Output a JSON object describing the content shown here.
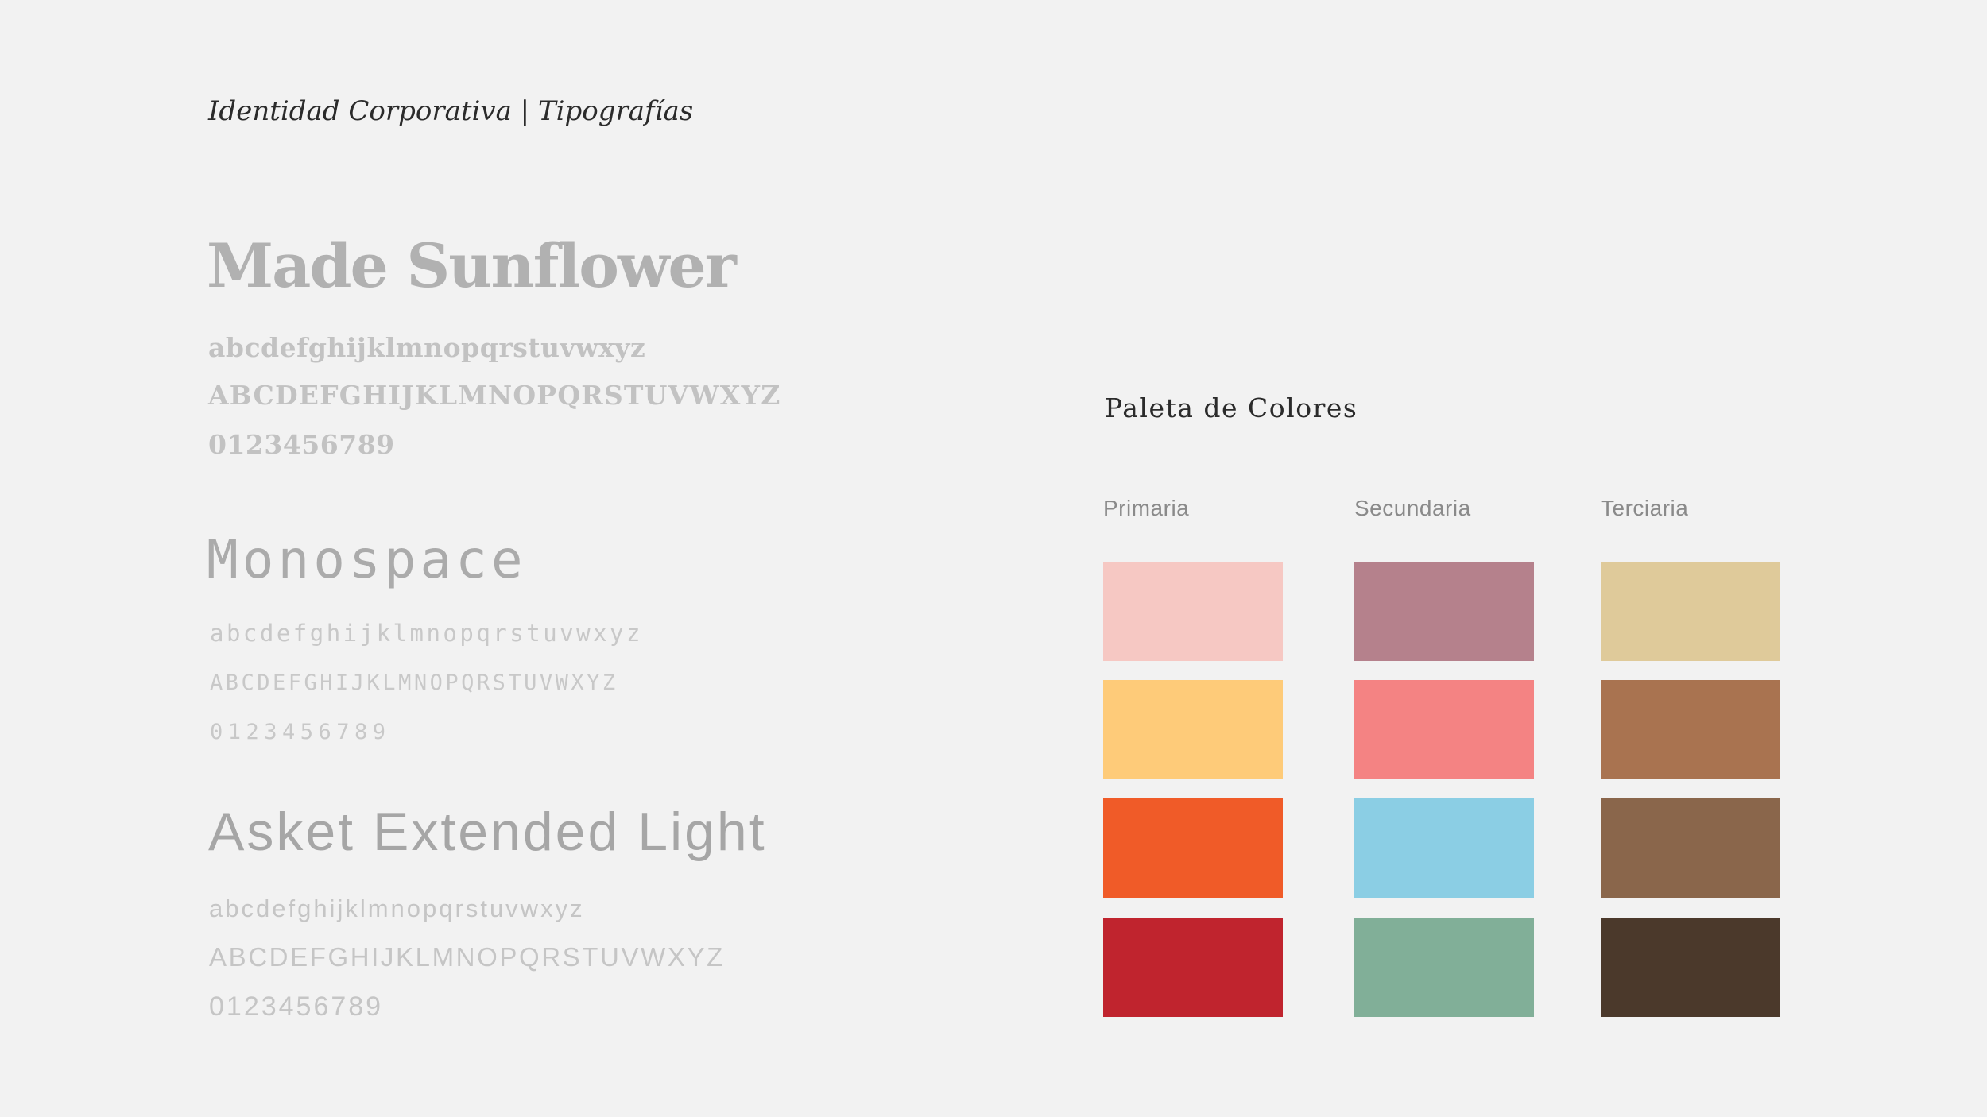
{
  "header": {
    "title": "Identidad Corporativa | Tipografías"
  },
  "typography": {
    "fonts": [
      {
        "name": "Made Sunflower",
        "lowercase": "abcdefghijklmnopqrstuvwxyz",
        "uppercase": "ABCDEFGHIJKLMNOPQRSTUVWXYZ",
        "numbers": "0123456789"
      },
      {
        "name": "Monospace",
        "lowercase": "abcdefghijklmnopqrstuvwxyz",
        "uppercase": "ABCDEFGHIJKLMNOPQRSTUVWXYZ",
        "numbers": "0123456789"
      },
      {
        "name": "Asket Extended Light",
        "lowercase": "abcdefghijklmnopqrstuvwxyz",
        "uppercase": "ABCDEFGHIJKLMNOPQRSTUVWXYZ",
        "numbers": "0123456789"
      }
    ]
  },
  "palette": {
    "title": "Paleta de Colores",
    "columns": [
      {
        "label": "Primaria",
        "colors": [
          "#f6c8c3",
          "#fecb79",
          "#f05b28",
          "#c0242e"
        ]
      },
      {
        "label": "Secundaria",
        "colors": [
          "#b5818c",
          "#f48383",
          "#8bcee4",
          "#81af98"
        ]
      },
      {
        "label": "Terciaria",
        "colors": [
          "#dfca9a",
          "#a97350",
          "#8a664b",
          "#4b392b"
        ]
      }
    ]
  }
}
